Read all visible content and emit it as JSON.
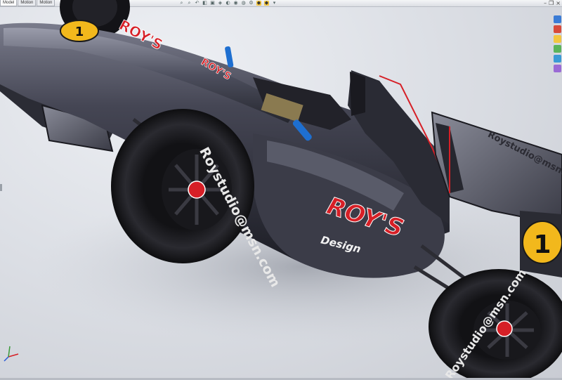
{
  "tabs": [
    {
      "label": "Model"
    },
    {
      "label": "Motion"
    },
    {
      "label": "Motion"
    }
  ],
  "heads_up_toolbar": {
    "icons": [
      "zoom-to-fit-icon",
      "zoom-area-icon",
      "previous-view-icon",
      "section-view-icon",
      "view-orientation-icon",
      "display-style-icon",
      "hide-show-icon",
      "edit-appearance-icon",
      "apply-scene-icon",
      "view-settings-icon",
      "realview-icon",
      "shadows-icon",
      "render-icon"
    ]
  },
  "window_controls": [
    "minimize",
    "restore",
    "close"
  ],
  "task_pane": {
    "icons": [
      "resources-icon",
      "design-library-icon",
      "file-explorer-icon",
      "view-palette-icon",
      "appearances-icon",
      "custom-properties-icon"
    ],
    "colors": [
      "#3a7bd5",
      "#d84a3a",
      "#f2c640",
      "#5ab45a",
      "#3a9ad5",
      "#9a6ad5"
    ]
  },
  "car": {
    "nose_badge_number": "1",
    "nose_logo": "ROY'S",
    "sidepod_logo": "ROY'S",
    "sidepod_sublogo": "Design",
    "tire_text_front": "Roystudio@msn.com",
    "tire_text_rear": "Roystudio@msn.com",
    "wing_text": "Roystudio@msn.com",
    "rear_badge_number": "1",
    "small_label": "ROY'S",
    "accent_red": "#d61f26",
    "body_color": "#3c3d48",
    "badge_yellow": "#f2b81c",
    "mirror_blue": "#1e6fd0"
  }
}
